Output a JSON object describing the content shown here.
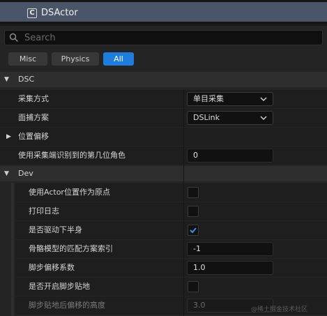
{
  "header": {
    "actor_name": "DSActor",
    "actor_icon_letter": "C"
  },
  "search": {
    "placeholder": "Search"
  },
  "filter_tabs": [
    {
      "label": "Misc",
      "active": false
    },
    {
      "label": "Physics",
      "active": false
    },
    {
      "label": "All",
      "active": true
    }
  ],
  "sections": {
    "dsc": {
      "title": "DSC",
      "expanded": true
    },
    "dev": {
      "title": "Dev",
      "expanded": true
    }
  },
  "dsc_props": {
    "capture_mode": {
      "label": "采集方式",
      "value": "单目采集"
    },
    "face_capture": {
      "label": "面捕方案",
      "value": "DSLink"
    },
    "position_offset": {
      "label": "位置偏移",
      "expanded": false
    },
    "nth_role": {
      "label": "使用采集端识别到的第几位角色",
      "value": "0"
    }
  },
  "dev_props": {
    "use_actor_origin": {
      "label": "使用Actor位置作为原点",
      "checked": false
    },
    "print_log": {
      "label": "打印日志",
      "checked": false
    },
    "drive_lower_body": {
      "label": "是否驱动下半身",
      "checked": true
    },
    "skeleton_index": {
      "label": "骨骼模型的匹配方案索引",
      "value": "-1"
    },
    "foot_offset_coef": {
      "label": "脚步偏移系数",
      "value": "1.0"
    },
    "foot_ground_snap": {
      "label": "是否开启脚步贴地",
      "checked": false
    },
    "snap_offset_height": {
      "label": "脚步贴地后偏移的高度",
      "value": "3.0",
      "disabled": true
    }
  },
  "watermark": "@稀土掘金技术社区",
  "colors": {
    "accent": "#1f7ddd",
    "selection": "#4a5668",
    "panel": "#242424",
    "row": "#1e1e1e"
  }
}
